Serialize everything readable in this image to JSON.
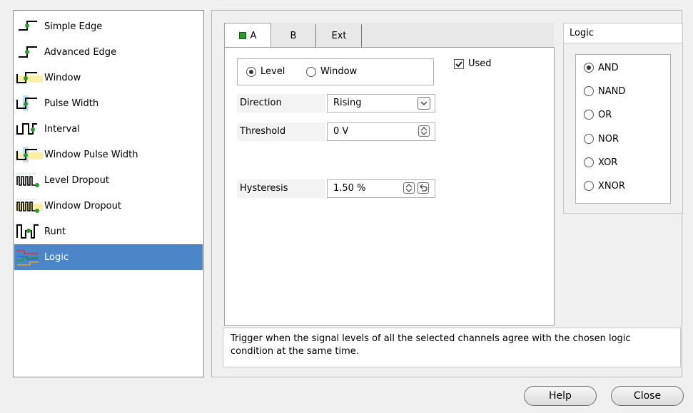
{
  "trigger_types": [
    {
      "label": "Simple Edge",
      "icon": "simple-edge-icon",
      "selected": false
    },
    {
      "label": "Advanced Edge",
      "icon": "advanced-edge-icon",
      "selected": false
    },
    {
      "label": "Window",
      "icon": "window-icon",
      "selected": false
    },
    {
      "label": "Pulse Width",
      "icon": "pulse-width-icon",
      "selected": false
    },
    {
      "label": "Interval",
      "icon": "interval-icon",
      "selected": false
    },
    {
      "label": "Window Pulse Width",
      "icon": "window-pulse-width-icon",
      "selected": false
    },
    {
      "label": "Level Dropout",
      "icon": "level-dropout-icon",
      "selected": false
    },
    {
      "label": "Window Dropout",
      "icon": "window-dropout-icon",
      "selected": false
    },
    {
      "label": "Runt",
      "icon": "runt-icon",
      "selected": false
    },
    {
      "label": "Logic",
      "icon": "logic-icon",
      "selected": true
    }
  ],
  "tabs": [
    {
      "label": "A",
      "active": true,
      "enabled_indicator": true
    },
    {
      "label": "B",
      "active": false
    },
    {
      "label": "Ext",
      "active": false
    }
  ],
  "channel": {
    "mode_options": [
      {
        "label": "Level",
        "checked": true
      },
      {
        "label": "Window",
        "checked": false
      }
    ],
    "used_label": "Used",
    "used_checked": true,
    "direction_label": "Direction",
    "direction_value": "Rising",
    "threshold_label": "Threshold",
    "threshold_value": "0 V",
    "hysteresis_label": "Hysteresis",
    "hysteresis_value": "1.50 %"
  },
  "logic": {
    "title": "Logic",
    "options": [
      {
        "label": "AND",
        "checked": true
      },
      {
        "label": "NAND",
        "checked": false
      },
      {
        "label": "OR",
        "checked": false
      },
      {
        "label": "NOR",
        "checked": false
      },
      {
        "label": "XOR",
        "checked": false
      },
      {
        "label": "XNOR",
        "checked": false
      }
    ]
  },
  "description": "Trigger when the signal levels of all the selected channels agree with the chosen logic condition at the same time.",
  "buttons": {
    "help": "Help",
    "close": "Close"
  },
  "colors": {
    "selection": "#4a86c8",
    "green_indicator": "#2a9a2a"
  }
}
